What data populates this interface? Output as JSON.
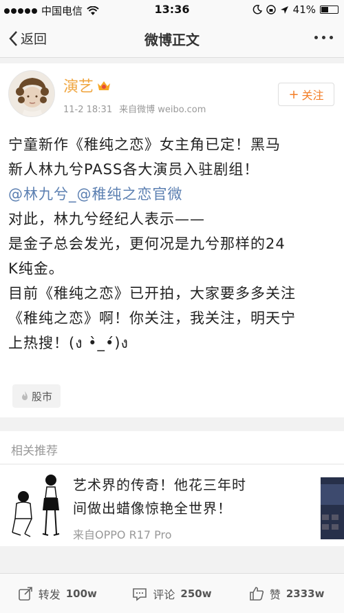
{
  "status_bar": {
    "carrier": "中国电信",
    "time": "13:36",
    "battery": "41%"
  },
  "nav": {
    "back_label": "返回",
    "title": "微博正文"
  },
  "post": {
    "username": "演艺",
    "time": "11-2 18:31",
    "source": "来自微博 weibo.com",
    "follow_label": "关注",
    "lines": [
      "宁童新作《稚纯之恋》女主角已定！黑马",
      "新人林九兮PASS各大演员入驻剧组！",
      "@林九兮_@稚纯之恋官微",
      "对此，林九兮经纪人表示——",
      "是金子总会发光，更何况是九兮那样的24",
      "K纯金。",
      "目前《稚纯之恋》已开拍，大家要多多关注",
      "《稚纯之恋》啊！你关注，我关注，明天宁",
      "上热搜！(ง •̀_•́)ง"
    ],
    "tag": "股市"
  },
  "related": {
    "header": "相关推荐",
    "title_line1": "艺术界的传奇！他花三年时",
    "title_line2": "间做出蜡像惊艳全世界！",
    "source": "来自OPPO R17 Pro"
  },
  "bottom_bar": {
    "repost_label": "转发",
    "repost_count": "100w",
    "comment_label": "评论",
    "comment_count": "250w",
    "like_label": "赞",
    "like_count": "2333w"
  },
  "colors": {
    "accent_orange": "#f37d26",
    "username": "#f0a640",
    "mention_blue": "#5b7fb1"
  }
}
